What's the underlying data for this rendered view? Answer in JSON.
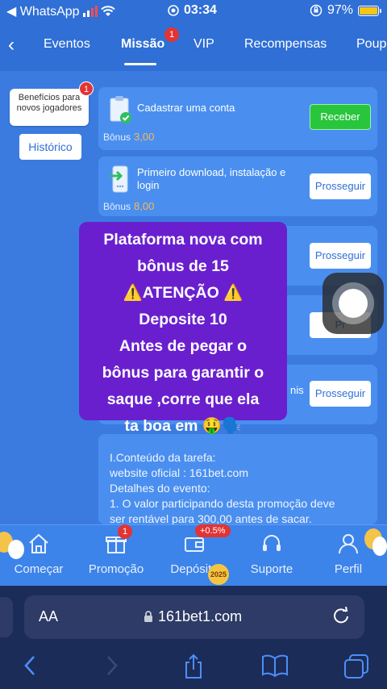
{
  "statusbar": {
    "back_app": "◀ WhatsApp",
    "time": "03:34",
    "battery": "97%"
  },
  "tabs": [
    {
      "label": "Eventos"
    },
    {
      "label": "Missão",
      "badge": "1"
    },
    {
      "label": "VIP"
    },
    {
      "label": "Recompensas"
    },
    {
      "label": "Poup"
    }
  ],
  "sidebar": {
    "benefit_label": "Benefícios para novos jogadores",
    "benefit_badge": "1",
    "history_label": "Histórico"
  },
  "tasks": [
    {
      "title": "Cadastrar uma conta",
      "bonus_label": "Bônus",
      "bonus_value": "3,00",
      "button": "Receber"
    },
    {
      "title": "Primeiro download, instalação e login",
      "bonus_label": "Bônus",
      "bonus_value": "8,00",
      "button": "Prosseguir"
    },
    {
      "button": "Prosseguir"
    },
    {
      "button": "Pr"
    },
    {
      "title_fragment": "nis",
      "button": "Prosseguir"
    }
  ],
  "description": {
    "heading": "I.Conteúdo da tarefa:",
    "site": "website oficial : 161bet.com",
    "details_heading": "Detalhes do evento:",
    "line1": "1. O valor participando desta promoção deve",
    "line2": "ser rentável para 300,00 antes de sacar."
  },
  "promo": {
    "line1": "Plataforma nova com",
    "line2": "bônus de 15",
    "line3": "⚠️ATENÇÃO ⚠️",
    "line4": "Deposite 10",
    "line5": "Antes de pegar o",
    "line6": "bônus para garantir o",
    "line7": "saque ,corre que ela",
    "line8": "ta boa em 🤑🗣️"
  },
  "appnav": [
    {
      "label": "Começar"
    },
    {
      "label": "Promoção",
      "badge": "1"
    },
    {
      "label": "Depósito",
      "badge": "+0.5%"
    },
    {
      "label": "Suporte"
    },
    {
      "label": "Perfil"
    }
  ],
  "year_badge": "2025",
  "browser": {
    "text_size": "AA",
    "url": "161bet1.com"
  },
  "colors": {
    "accent": "#2f6fd6",
    "card": "#4a8ff0",
    "receive": "#28c53d",
    "promo": "#6a1fcf",
    "bonus": "#f7b955"
  }
}
